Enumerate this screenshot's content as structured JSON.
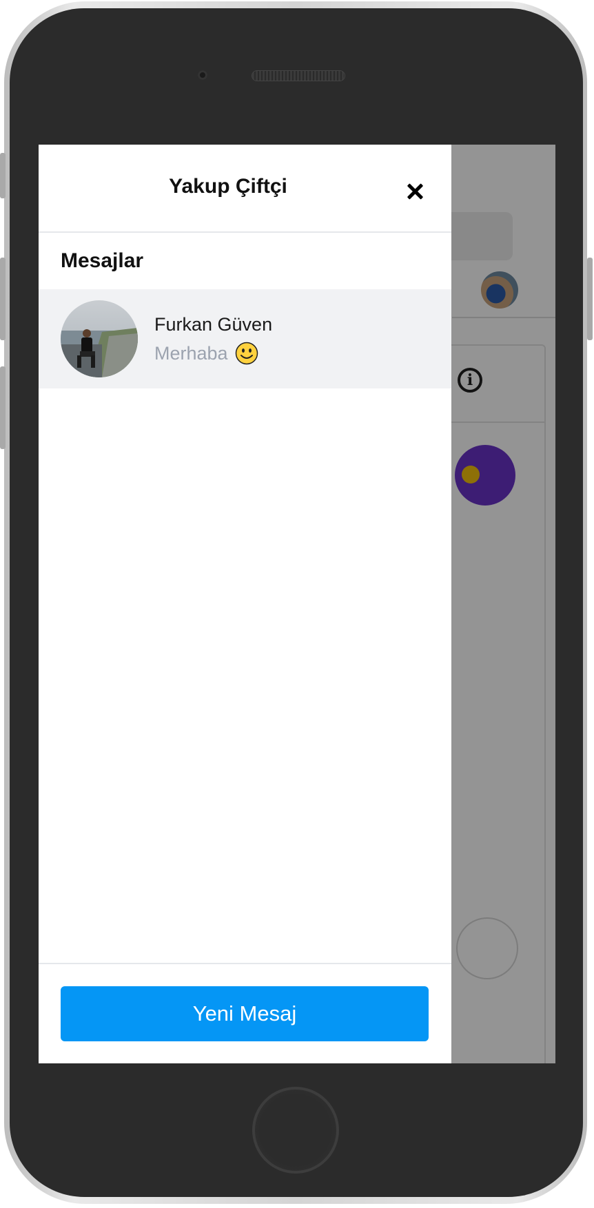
{
  "drawer": {
    "title": "Yakup Çiftçi",
    "close_icon": "close-icon",
    "section_title": "Mesajlar",
    "conversations": [
      {
        "name": "Furkan Güven",
        "preview": "Merhaba",
        "preview_emoji": "smile-emoji-icon"
      }
    ],
    "new_message_label": "Yeni Mesaj"
  },
  "colors": {
    "primary_button": "#0596f5",
    "selected_row": "#f1f2f4",
    "muted_text": "#9ca3af",
    "background_accent": "#6a33c9"
  }
}
